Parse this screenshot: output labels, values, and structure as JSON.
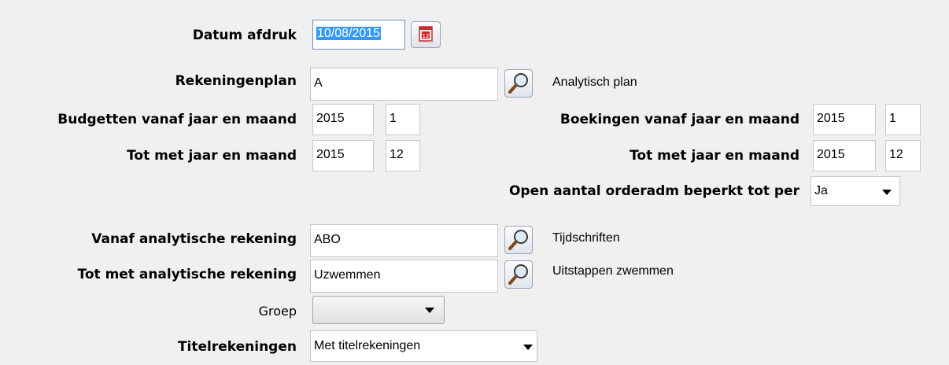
{
  "datum": {
    "label": "Datum afdruk",
    "value": "10/08/2015"
  },
  "rekeningenplan": {
    "label": "Rekeningenplan",
    "value": "A",
    "description": "Analytisch plan"
  },
  "budgetten_vanaf": {
    "label": "Budgetten vanaf jaar en maand",
    "year": "2015",
    "month": "1"
  },
  "budgetten_tot": {
    "label": "Tot met jaar en maand",
    "year": "2015",
    "month": "12"
  },
  "boekingen_vanaf": {
    "label": "Boekingen vanaf jaar en maand",
    "year": "2015",
    "month": "1"
  },
  "boekingen_tot": {
    "label": "Tot met jaar en maand",
    "year": "2015",
    "month": "12"
  },
  "open_aantal": {
    "label": "Open aantal orderadm beperkt tot per",
    "value": "Ja"
  },
  "vanaf_analytisch": {
    "label": "Vanaf analytische rekening",
    "value": "ABO",
    "description": "Tijdschriften"
  },
  "tot_analytisch": {
    "label": "Tot met analytische rekening",
    "value": "Uzwemmen",
    "description": "Uitstappen zwemmen"
  },
  "groep": {
    "label": "Groep",
    "value": ""
  },
  "titelrekeningen": {
    "label": "Titelrekeningen",
    "value": "Met titelrekeningen"
  },
  "icons": {
    "calendar": "calendar-icon",
    "lookup": "magnifier-icon",
    "dropdown": "chevron-down-icon"
  },
  "colors": {
    "selection": "#3399ff",
    "panel": "#f0f0f0"
  }
}
